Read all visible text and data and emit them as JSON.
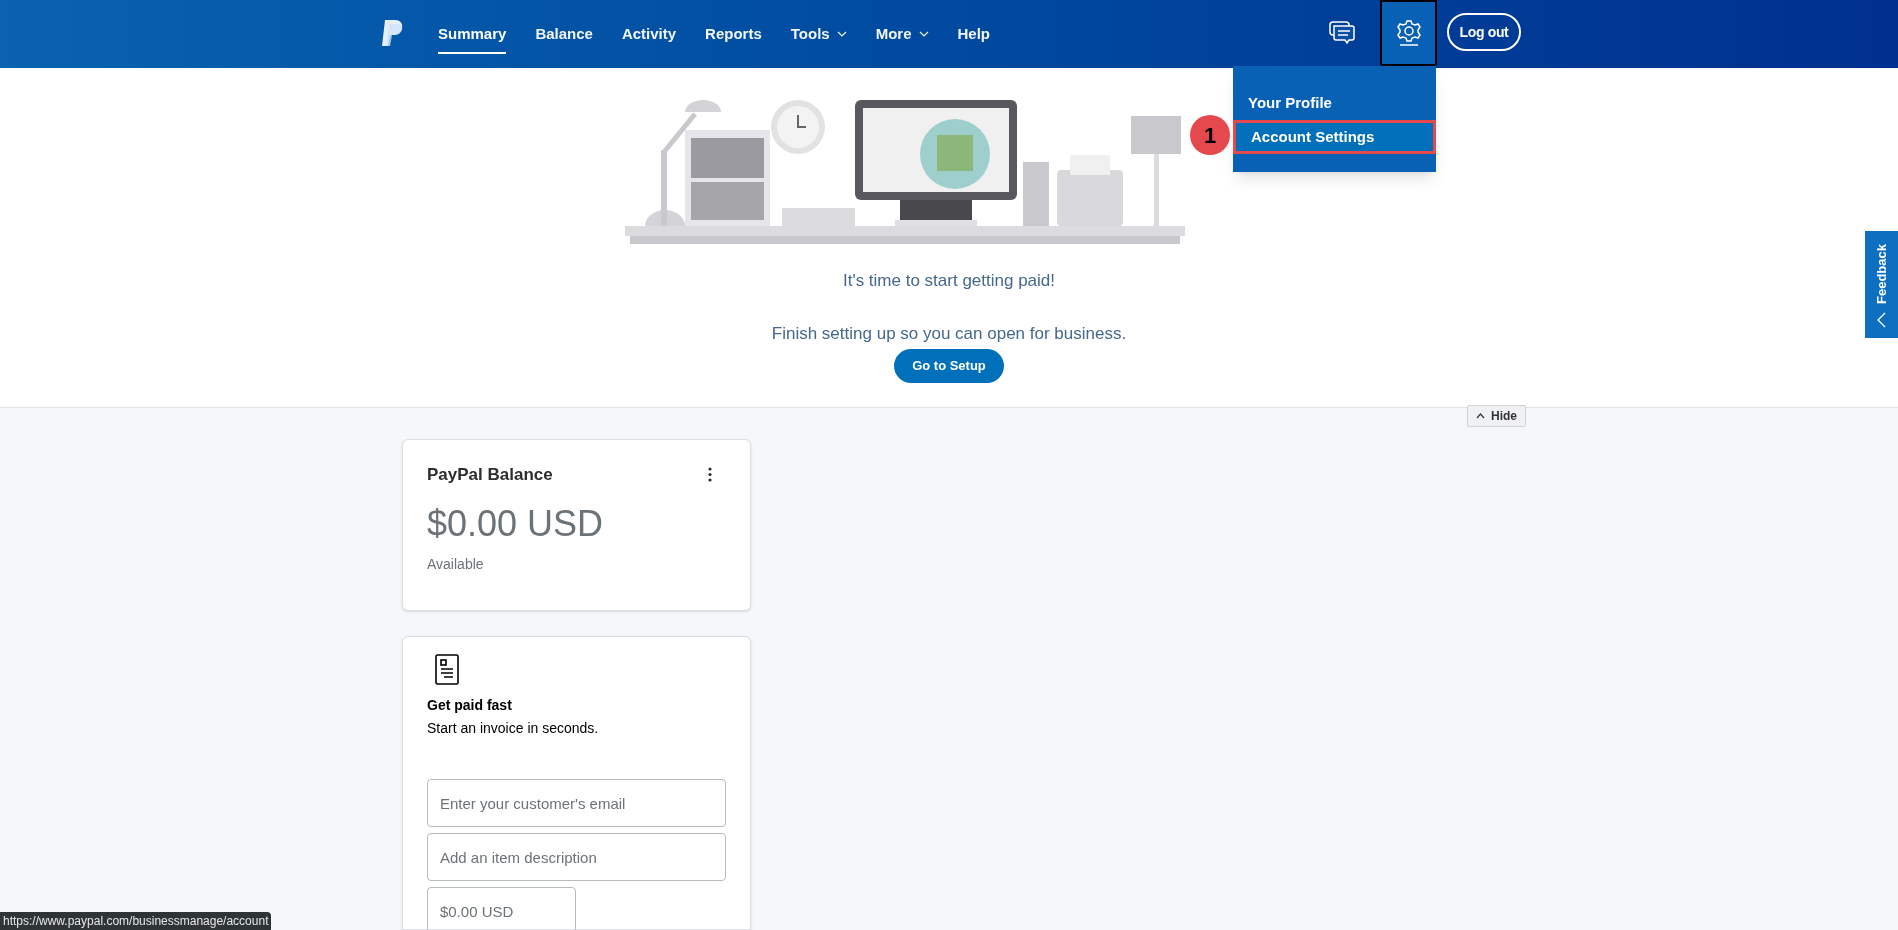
{
  "nav": {
    "items": [
      {
        "label": "Summary",
        "selected": true,
        "kind": "link"
      },
      {
        "label": "Balance",
        "selected": false,
        "kind": "link"
      },
      {
        "label": "Activity",
        "selected": false,
        "kind": "link"
      },
      {
        "label": "Reports",
        "selected": false,
        "kind": "link"
      },
      {
        "label": "Tools",
        "selected": false,
        "kind": "menu"
      },
      {
        "label": "More",
        "selected": false,
        "kind": "menu"
      },
      {
        "label": "Help",
        "selected": false,
        "kind": "link"
      }
    ],
    "settings_selected": true,
    "logout": "Log out"
  },
  "settings_menu": {
    "items": [
      {
        "label": "Your Profile",
        "selected": false
      },
      {
        "label": "Account Settings",
        "selected": true
      }
    ],
    "step_badge": "1"
  },
  "banner": {
    "headline": "It's time to start getting paid!",
    "message": "Finish setting up so you can open for business.",
    "button": "Go to Setup",
    "hide": "Hide"
  },
  "balance_card": {
    "title": "PayPal Balance",
    "amount": "$0.00 USD",
    "caption": "Available"
  },
  "invoice_card": {
    "title": "Get paid fast",
    "subtitle": "Start an invoice in seconds.",
    "fields": [
      {
        "placeholder": "Enter your customer's email"
      },
      {
        "placeholder": "Add an item description"
      },
      {
        "placeholder": "$0.00 USD"
      }
    ]
  },
  "feedback": "Feedback",
  "status_url": "https://www.paypal.com/businessmanage/account"
}
